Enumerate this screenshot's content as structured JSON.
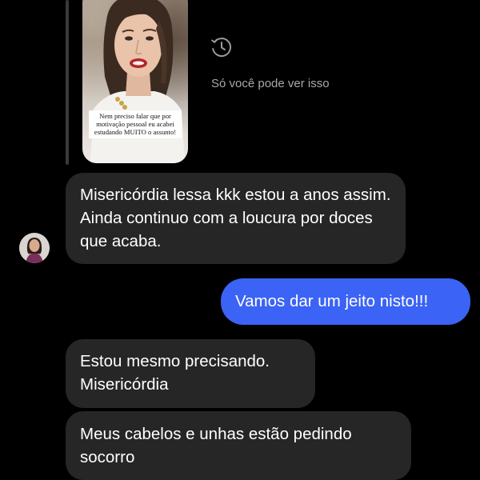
{
  "story_reply": {
    "caption": "Nem preciso falar que por motivação pessoal eu acabei estudando MUITO o assunto!",
    "private_note": "Só você pode ver isso",
    "icon": "history-clock-icon"
  },
  "messages": [
    {
      "direction": "incoming",
      "text": "Misericórdia lessa kkk estou a anos assim. Ainda continuo com a loucura por doces que acaba."
    },
    {
      "direction": "outgoing",
      "text": "Vamos dar um jeito nisto!!!"
    },
    {
      "direction": "incoming",
      "text": "Estou mesmo precisando. Misericórdia"
    },
    {
      "direction": "incoming",
      "text": "Meus cabelos e unhas estão pedindo socorro"
    }
  ],
  "colors": {
    "background": "#000000",
    "incoming_bubble": "#262626",
    "outgoing_bubble": "#3b63f5",
    "muted_text": "#a8a8a8"
  }
}
